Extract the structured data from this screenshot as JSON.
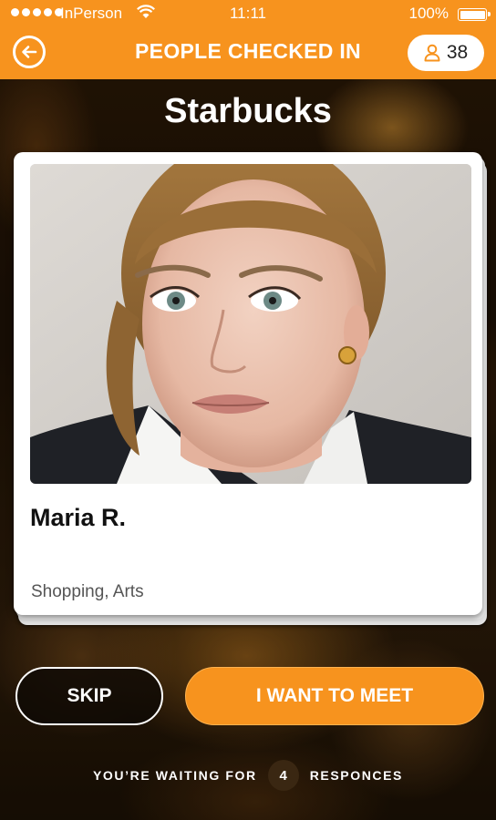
{
  "status_bar": {
    "carrier": "InPerson",
    "time": "11:11",
    "battery": "100%"
  },
  "header": {
    "back_icon": "arrow-left-icon",
    "title": "PEOPLE CHECKED IN",
    "people_icon": "person-icon",
    "checked_in_count": "38"
  },
  "venue": {
    "name": "Starbucks"
  },
  "profile": {
    "name": "Maria R.",
    "interests": "Shopping, Arts"
  },
  "actions": {
    "skip_label": "SKIP",
    "meet_label": "I WANT TO MEET"
  },
  "footer": {
    "waiting_prefix": "YOU’RE WAITING FOR",
    "responses_count": "4",
    "waiting_suffix": "RESPONCES"
  },
  "colors": {
    "accent": "#f7931e",
    "card": "#ffffff",
    "text_dark": "#111111"
  }
}
